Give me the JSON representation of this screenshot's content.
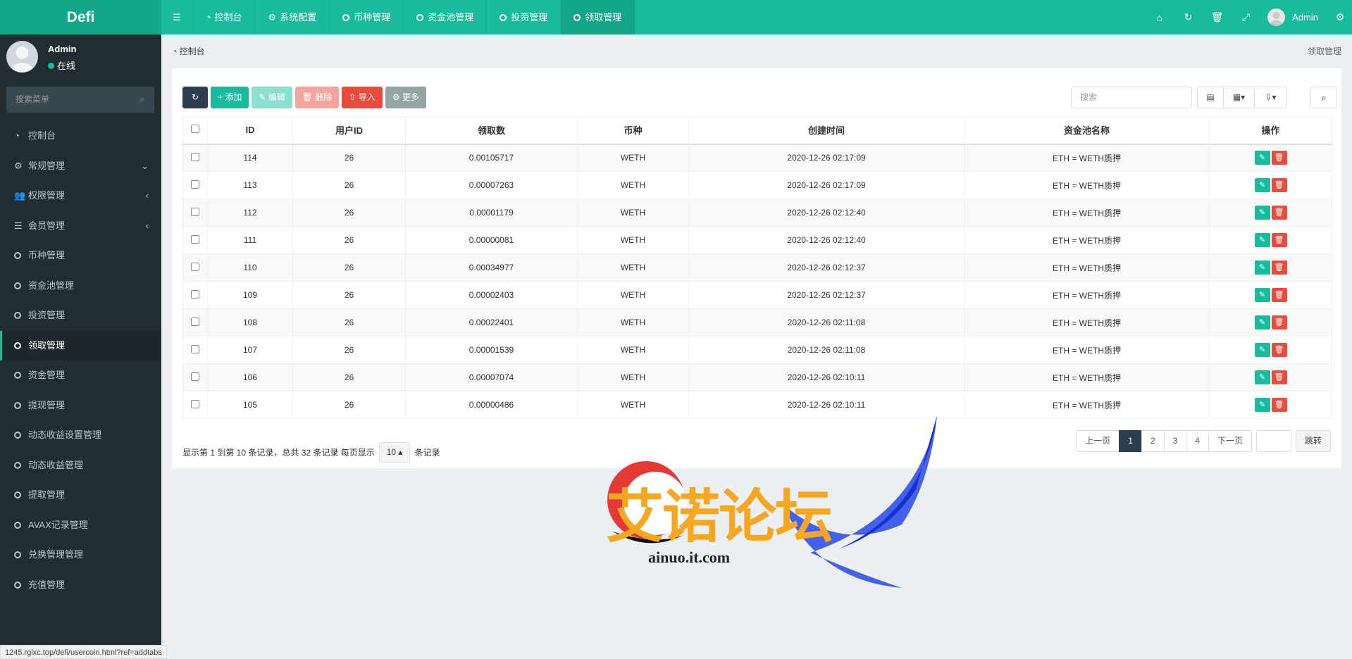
{
  "app": {
    "logo": "Defi"
  },
  "topnav": {
    "items": [
      {
        "label": "控制台",
        "icon": "dashboard-icon"
      },
      {
        "label": "系统配置",
        "icon": "gear-icon"
      },
      {
        "label": "币种管理",
        "icon": "circle-icon"
      },
      {
        "label": "资金池管理",
        "icon": "circle-icon"
      },
      {
        "label": "投资管理",
        "icon": "circle-icon"
      },
      {
        "label": "领取管理",
        "icon": "circle-icon",
        "active": true
      }
    ],
    "user": "Admin"
  },
  "sidebar": {
    "user": {
      "name": "Admin",
      "status": "在线"
    },
    "search_placeholder": "搜索菜单",
    "items": [
      {
        "label": "控制台"
      },
      {
        "label": "常规管理"
      },
      {
        "label": "权限管理"
      },
      {
        "label": "会员管理"
      },
      {
        "label": "币种管理"
      },
      {
        "label": "资金池管理"
      },
      {
        "label": "投资管理"
      },
      {
        "label": "领取管理",
        "active": true
      },
      {
        "label": "资金管理"
      },
      {
        "label": "提现管理"
      },
      {
        "label": "动态收益设置管理"
      },
      {
        "label": "动态收益管理"
      },
      {
        "label": "提取管理"
      },
      {
        "label": "AVAX记录管理"
      },
      {
        "label": "兑换管理管理"
      },
      {
        "label": "充值管理"
      }
    ]
  },
  "breadcrumb": {
    "left": "控制台",
    "right": "领取管理"
  },
  "toolbar": {
    "add": "添加",
    "edit": "编辑",
    "delete": "删除",
    "import": "导入",
    "more": "更多",
    "search_placeholder": "搜索"
  },
  "table": {
    "headers": [
      "ID",
      "用户ID",
      "领取数",
      "币种",
      "创建时间",
      "资金池名称",
      "操作"
    ],
    "rows": [
      [
        "114",
        "26",
        "0.00105717",
        "WETH",
        "2020-12-26 02:17:09",
        "ETH = WETH质押"
      ],
      [
        "113",
        "26",
        "0.00007263",
        "WETH",
        "2020-12-26 02:17:09",
        "ETH = WETH质押"
      ],
      [
        "112",
        "26",
        "0.00001179",
        "WETH",
        "2020-12-26 02:12:40",
        "ETH = WETH质押"
      ],
      [
        "111",
        "26",
        "0.00000081",
        "WETH",
        "2020-12-26 02:12:40",
        "ETH = WETH质押"
      ],
      [
        "110",
        "26",
        "0.00034977",
        "WETH",
        "2020-12-26 02:12:37",
        "ETH = WETH质押"
      ],
      [
        "109",
        "26",
        "0.00002403",
        "WETH",
        "2020-12-26 02:12:37",
        "ETH = WETH质押"
      ],
      [
        "108",
        "26",
        "0.00022401",
        "WETH",
        "2020-12-26 02:11:08",
        "ETH = WETH质押"
      ],
      [
        "107",
        "26",
        "0.00001539",
        "WETH",
        "2020-12-26 02:11:08",
        "ETH = WETH质押"
      ],
      [
        "106",
        "26",
        "0.00007074",
        "WETH",
        "2020-12-26 02:10:11",
        "ETH = WETH质押"
      ],
      [
        "105",
        "26",
        "0.00000486",
        "WETH",
        "2020-12-26 02:10:11",
        "ETH = WETH质押"
      ]
    ]
  },
  "pagination": {
    "info_prefix": "显示第 1 到第 10 条记录，总共 32 条记录 每页显示",
    "page_size": "10",
    "info_suffix": "条记录",
    "prev": "上一页",
    "pages": [
      "1",
      "2",
      "3",
      "4"
    ],
    "next": "下一页",
    "jump": "跳转"
  },
  "statusbar": "1245.rglxc.top/defi/usercoin.html?ref=addtabs",
  "watermark": {
    "cn": "艾诺论坛",
    "en": "ainuo.it.com"
  },
  "colors": {
    "primary": "#18bc9c",
    "sidebar": "#222d32",
    "danger": "#e74c3c",
    "dark": "#2c3e50"
  }
}
